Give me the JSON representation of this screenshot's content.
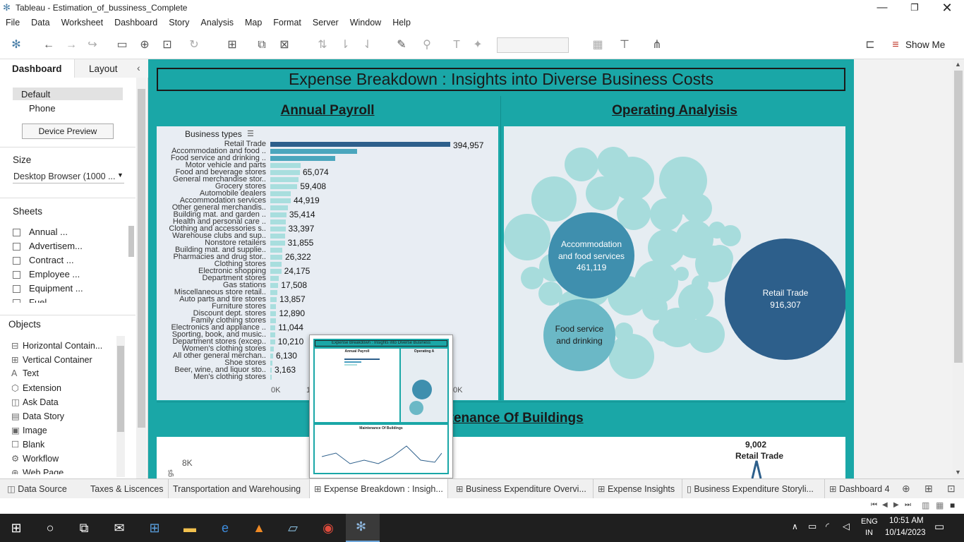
{
  "window": {
    "title": "Tableau - Estimation_of_bussiness_Complete"
  },
  "menu": [
    "File",
    "Data",
    "Worksheet",
    "Dashboard",
    "Story",
    "Analysis",
    "Map",
    "Format",
    "Server",
    "Window",
    "Help"
  ],
  "toolbar": {
    "show_me": "Show Me"
  },
  "leftpane": {
    "tabs": {
      "dashboard": "Dashboard",
      "layout": "Layout"
    },
    "devices": {
      "default": "Default",
      "phone": "Phone",
      "preview_btn": "Device Preview"
    },
    "size": {
      "title": "Size",
      "value": "Desktop Browser (1000 ..."
    },
    "sheets": {
      "title": "Sheets",
      "items": [
        "Annual ...",
        "Advertisem...",
        "Contract ...",
        "Employee ...",
        "Equipment ...",
        "Fuel"
      ]
    },
    "objects": {
      "title": "Objects",
      "items": [
        {
          "label": "Horizontal Contain...",
          "icon": "horizontal-container-icon",
          "glyph": "⊟"
        },
        {
          "label": "Vertical Container",
          "icon": "vertical-container-icon",
          "glyph": "⊞"
        },
        {
          "label": "Text",
          "icon": "text-icon",
          "glyph": "A"
        },
        {
          "label": "Extension",
          "icon": "extension-icon",
          "glyph": "⬡"
        },
        {
          "label": "Ask Data",
          "icon": "ask-data-icon",
          "glyph": "◫"
        },
        {
          "label": "Data Story",
          "icon": "data-story-icon",
          "glyph": "▤"
        },
        {
          "label": "Image",
          "icon": "image-icon",
          "glyph": "▣"
        },
        {
          "label": "Blank",
          "icon": "blank-icon",
          "glyph": "☐"
        },
        {
          "label": "Workflow",
          "icon": "workflow-icon",
          "glyph": "⚙"
        },
        {
          "label": "Web Page",
          "icon": "web-page-icon",
          "glyph": "⊕"
        }
      ]
    }
  },
  "dashboard": {
    "title": "Expense Breakdown : Insights into Diverse Business Costs",
    "payroll_title": "Annual Payroll",
    "operating_title": "Operating Analyisis",
    "maintenance_title": "Maintenance Of Buildings",
    "payroll_header": "Business types",
    "maint_label_value": "9,002",
    "maint_label_name": "Retail Trade",
    "maint_axis_tick": "8K"
  },
  "chart_data": [
    {
      "type": "bar",
      "title": "Annual Payroll",
      "axis_ticks": [
        "0K",
        "1",
        "0K"
      ],
      "categories": [
        "Retail Trade",
        "Accommodation and food ..",
        "Food service and drinking ..",
        "Motor vehicle and parts",
        "Food and beverage stores",
        "General merchandise stor..",
        "Grocery stores",
        "Automobile dealers",
        "Accommodation services",
        "Other general merchandis..",
        "Building mat. and garden ..",
        "Health and personal care ..",
        "Clothing and accessories s..",
        "Warehouse clubs and sup..",
        "Nonstore retailers",
        "Building mat. and supplie..",
        "Pharmacies and drug stor..",
        "Clothing stores",
        "Electronic shopping",
        "Department stores",
        "Gas stations",
        "Miscellaneous store retail..",
        "Auto parts and tire stores",
        "Furniture stores",
        "Discount dept. stores",
        "Family clothing stores",
        "Electronics and appliance ..",
        "Sporting, book, and music..",
        "Department stores (excep..",
        "Women's clothing stores",
        "All other general merchan..",
        "Shoe stores",
        "Beer, wine, and liquor sto..",
        "Men's clothing stores"
      ],
      "values": [
        394957,
        190000,
        143000,
        66000,
        65074,
        62000,
        59408,
        45000,
        44919,
        38000,
        35414,
        34000,
        33397,
        32000,
        31855,
        27000,
        26322,
        25000,
        24175,
        19000,
        17508,
        15000,
        13857,
        13000,
        12890,
        12000,
        11044,
        10500,
        10210,
        7000,
        6130,
        4000,
        3163,
        2000
      ],
      "labels": [
        "394,957",
        "",
        "",
        "",
        "65,074",
        "",
        "59,408",
        "",
        "44,919",
        "",
        "35,414",
        "",
        "33,397",
        "",
        "31,855",
        "",
        "26,322",
        "",
        "24,175",
        "",
        "17,508",
        "",
        "13,857",
        "",
        "12,890",
        "",
        "11,044",
        "",
        "10,210",
        "",
        "6,130",
        "",
        "3,163",
        ""
      ]
    },
    {
      "type": "bubble",
      "title": "Operating Analyisis",
      "labeled": [
        {
          "name": "Retail Trade",
          "label": "916,307",
          "value": 916307,
          "color": "#2d5f8b"
        },
        {
          "name": "Accommodation and food services",
          "label": "461,119",
          "value": 461119,
          "color": "#3f8fae"
        },
        {
          "name": "Food service and drinking",
          "label": "",
          "value": 260000,
          "color": "#6bb8c6"
        }
      ]
    }
  ],
  "tabs": [
    "Data Source",
    "Taxes & Liscences",
    "Transportation and Warehousing",
    "Expense Breakdown : Insigh...",
    "Business Expenditure Overvi...",
    "Expense Insights",
    "Business Expenditure Storyli...",
    "Dashboard 4"
  ],
  "active_tab": "Expense Breakdown : Insigh...",
  "thumbnail": {
    "title": "Expense Breakdown : Insights into Diverse Business",
    "payroll": "Annual Payroll",
    "operating": "Operating A",
    "maint": "Maintenance Of Buildings"
  },
  "tray": {
    "lang": "ENG",
    "region": "IN",
    "time": "10:51 AM",
    "date": "10/14/2023"
  }
}
